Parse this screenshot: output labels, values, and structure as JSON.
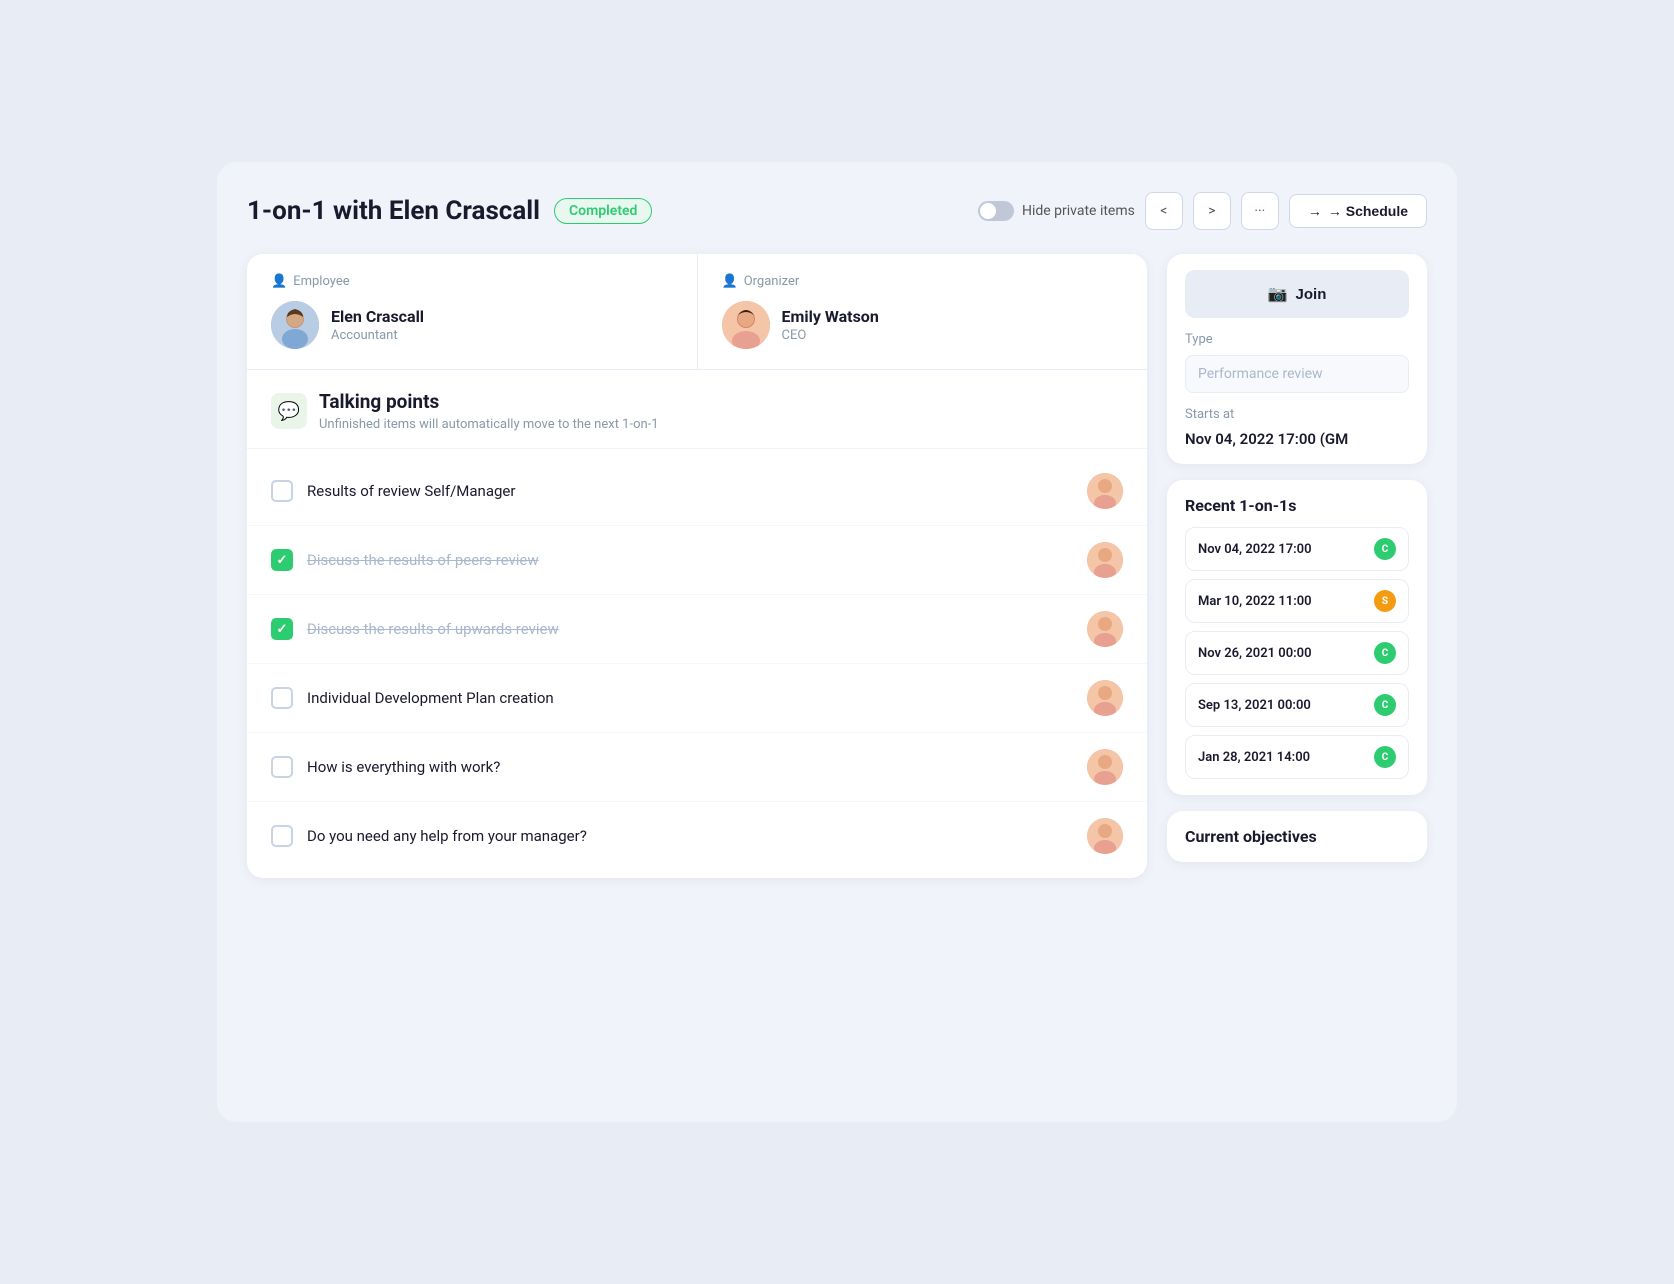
{
  "header": {
    "title": "1-on-1 with Elen Crascall",
    "badge": "Completed",
    "hide_private_label": "Hide private items",
    "schedule_label": "→ Schedule",
    "nav_prev": "<",
    "nav_next": ">",
    "more": "···"
  },
  "participants": {
    "employee": {
      "role_label": "Employee",
      "name": "Elen Crascall",
      "title": "Accountant"
    },
    "organizer": {
      "role_label": "Organizer",
      "name": "Emily Watson",
      "title": "CEO"
    }
  },
  "talking_points": {
    "title": "Talking points",
    "subtitle": "Unfinished items will automatically move to the next 1-on-1",
    "items": [
      {
        "id": 1,
        "text": "Results of review Self/Manager",
        "completed": false
      },
      {
        "id": 2,
        "text": "Discuss the results of peers review",
        "completed": true
      },
      {
        "id": 3,
        "text": "Discuss the results of upwards review",
        "completed": true
      },
      {
        "id": 4,
        "text": "Individual Development Plan creation",
        "completed": false
      },
      {
        "id": 5,
        "text": "How is everything with work?",
        "completed": false
      },
      {
        "id": 6,
        "text": "Do you need any help from your manager?",
        "completed": false
      }
    ]
  },
  "right_panel": {
    "join_label": "Join",
    "type_section": {
      "label": "Type",
      "value": "Performance review"
    },
    "starts_section": {
      "label": "Starts at",
      "value": "Nov 04, 2022 17:00 (GM"
    },
    "recent_ones": {
      "header": "Recent 1-on-1s",
      "items": [
        {
          "date": "Nov 04, 2022 17:00",
          "badge": "C",
          "badge_color": "green"
        },
        {
          "date": "Mar 10, 2022 11:00",
          "badge": "S",
          "badge_color": "yellow"
        },
        {
          "date": "Nov 26, 2021 00:00",
          "badge": "C",
          "badge_color": "green"
        },
        {
          "date": "Sep 13, 2021 00:00",
          "badge": "C",
          "badge_color": "green"
        },
        {
          "date": "Jan 28, 2021 14:00",
          "badge": "C",
          "badge_color": "green"
        }
      ]
    },
    "current_objectives": {
      "header": "Current objectives"
    }
  },
  "colors": {
    "accent_green": "#2ecc71",
    "accent_yellow": "#f39c12",
    "completed_badge_bg": "#e8f8f0",
    "completed_badge_text": "#2ecc71"
  }
}
